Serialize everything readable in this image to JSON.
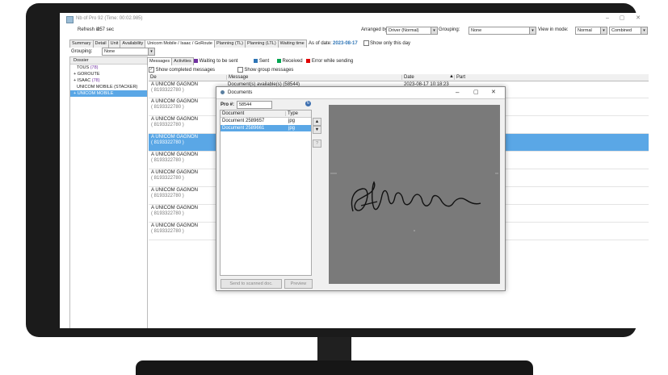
{
  "window": {
    "title": "Nb of Pro 92 (Time: 00:02.985)",
    "refresh_label": "Refresh in:",
    "refresh_value": "257 sec",
    "arranged_by_label": "Arranged by:",
    "arranged_by_value": "Driver (Normal)",
    "grouping_label": "Grouping:",
    "grouping_value": "None",
    "view_mode_label": "View in mode:",
    "view_mode_value": "Normal",
    "view_mode_value2": "Combined"
  },
  "tabs": [
    "Summary",
    "Detail",
    "Unit",
    "Availability",
    "Unicom Mobile / Isaac / GoRoute",
    "Planning (TL)",
    "Planning (LTL)",
    "Waiting time"
  ],
  "as_of": {
    "label": "As of date:",
    "date": "2023-08-17",
    "checkbox_label": "Show only this day"
  },
  "left_grouping": {
    "label": "Grouping:",
    "value": "None"
  },
  "sidebar": {
    "header": "Dossier",
    "items": [
      {
        "label": "TOUS",
        "count": "(78)"
      },
      {
        "label": "GOROUTE",
        "count": ""
      },
      {
        "label": "ISAAC",
        "count": "(78)"
      },
      {
        "label": "UNICOM MOBILE (STACKER)",
        "count": ""
      },
      {
        "label": "UNICOM MOBILE",
        "count": ""
      }
    ]
  },
  "msg_tabs": [
    "Messages",
    "Activities"
  ],
  "legend": [
    {
      "label": "Waiting to be sent",
      "color": "#7030a0"
    },
    {
      "label": "Sent",
      "color": "#2e75b6"
    },
    {
      "label": "Received",
      "color": "#00a651"
    },
    {
      "label": "Error while sending",
      "color": "#e00000"
    }
  ],
  "options": {
    "show_completed": "Show completed messages",
    "show_group": "Show group messages"
  },
  "columns": {
    "de": "De",
    "message": "Message",
    "date": "Date",
    "part": "Part"
  },
  "rows": [
    {
      "from": "A UNICOM GAGNON",
      "phone": "( 8193322780 )",
      "message": "Document(s) available(s) (58544)",
      "date": "2023-08-17 10:18:23"
    },
    {
      "from": "A UNICOM GAGNON",
      "phone": "( 8193322780 )",
      "message": "",
      "date": ""
    },
    {
      "from": "A UNICOM GAGNON",
      "phone": "( 8193322780 )",
      "message": "",
      "date": ""
    },
    {
      "from": "A UNICOM GAGNON",
      "phone": "( 8193322780 )",
      "message": "",
      "date": ""
    },
    {
      "from": "A UNICOM GAGNON",
      "phone": "( 8193322780 )",
      "message": "",
      "date": ""
    },
    {
      "from": "A UNICOM GAGNON",
      "phone": "( 8193322780 )",
      "message": "",
      "date": ""
    },
    {
      "from": "A UNICOM GAGNON",
      "phone": "( 8193322780 )",
      "message": "",
      "date": ""
    },
    {
      "from": "A UNICOM GAGNON",
      "phone": "( 8193322780 )",
      "message": "",
      "date": ""
    },
    {
      "from": "A UNICOM GAGNON",
      "phone": "( 8193322780 )",
      "message": "",
      "date": ""
    }
  ],
  "dialog": {
    "title": "Documents",
    "pro_label": "Pro #:",
    "pro_value": "58544",
    "col_document": "Document",
    "col_type": "Type",
    "docs": [
      {
        "name": "Document 2589657",
        "type": "jpg"
      },
      {
        "name": "Document 2589661",
        "type": "jpg"
      }
    ],
    "send_button": "Send to scanned doc.",
    "preview_button": "Preview",
    "question": "?"
  }
}
